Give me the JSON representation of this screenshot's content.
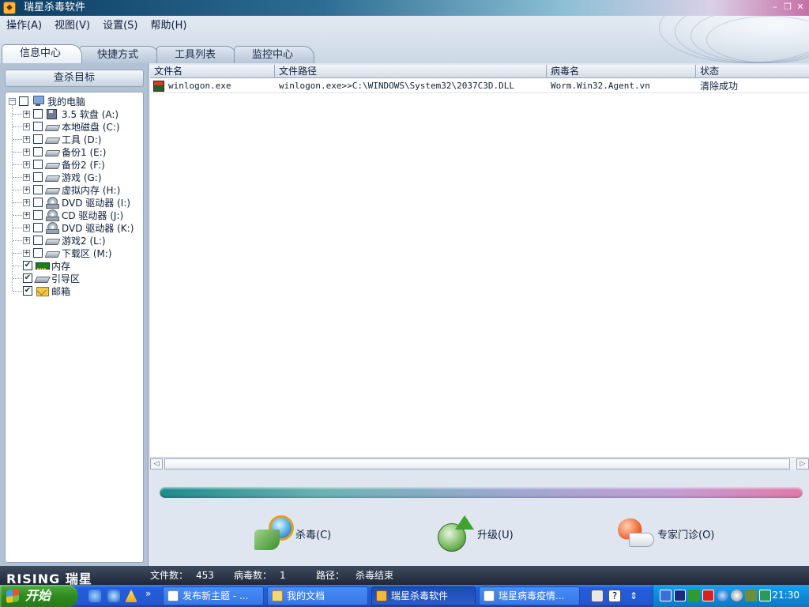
{
  "window": {
    "title": "瑞星杀毒软件",
    "icon": "rising-lion-icon",
    "controls": [
      "minimize-icon",
      "restore-icon",
      "close-icon"
    ]
  },
  "menu": [
    {
      "label": "操作(A)"
    },
    {
      "label": "视图(V)"
    },
    {
      "label": "设置(S)"
    },
    {
      "label": "帮助(H)"
    }
  ],
  "tabs": [
    {
      "label": "信息中心",
      "active": true
    },
    {
      "label": "快捷方式",
      "active": false
    },
    {
      "label": "工具列表",
      "active": false
    },
    {
      "label": "监控中心",
      "active": false
    }
  ],
  "left_panel": {
    "header": "查杀目标",
    "tree": {
      "root": {
        "label": "我的电脑",
        "icon": "computer-icon",
        "checked": false
      },
      "drives": [
        {
          "label": "3.5 软盘 (A:)",
          "icon": "floppy-icon",
          "checked": false
        },
        {
          "label": "本地磁盘 (C:)",
          "icon": "hard-disk-icon",
          "checked": false
        },
        {
          "label": "工具 (D:)",
          "icon": "hard-disk-icon",
          "checked": false
        },
        {
          "label": "备份1 (E:)",
          "icon": "hard-disk-icon",
          "checked": false
        },
        {
          "label": "备份2 (F:)",
          "icon": "hard-disk-icon",
          "checked": false
        },
        {
          "label": "游戏 (G:)",
          "icon": "hard-disk-icon",
          "checked": false
        },
        {
          "label": "虚拟内存 (H:)",
          "icon": "hard-disk-icon",
          "checked": false
        },
        {
          "label": "DVD 驱动器 (I:)",
          "icon": "dvd-drive-icon",
          "checked": false
        },
        {
          "label": "CD 驱动器 (J:)",
          "icon": "cd-drive-icon",
          "checked": false
        },
        {
          "label": "DVD 驱动器 (K:)",
          "icon": "dvd-drive-icon",
          "checked": false
        },
        {
          "label": "游戏2 (L:)",
          "icon": "hard-disk-icon",
          "checked": false
        },
        {
          "label": "下载区 (M:)",
          "icon": "hard-disk-icon",
          "checked": false
        }
      ],
      "others": [
        {
          "label": "内存",
          "icon": "memory-icon",
          "checked": true
        },
        {
          "label": "引导区",
          "icon": "boot-sector-icon",
          "checked": true
        },
        {
          "label": "邮箱",
          "icon": "mailbox-icon",
          "checked": true
        }
      ]
    }
  },
  "results_table": {
    "columns": [
      "文件名",
      "文件路径",
      "病毒名",
      "状态"
    ],
    "rows": [
      {
        "icon": "virus-file-icon",
        "filename": "winlogon.exe",
        "path": "winlogon.exe>>C:\\WINDOWS\\System32\\2037C3D.DLL",
        "virus": "Worm.Win32.Agent.vn",
        "status": "清除成功"
      }
    ]
  },
  "progress": {
    "value": 1.0
  },
  "actions": [
    {
      "label": "杀毒(C)",
      "icon": "scan-magnifier-icon"
    },
    {
      "label": "升级(U)",
      "icon": "upgrade-globe-icon"
    },
    {
      "label": "专家门诊(O)",
      "icon": "expert-clinic-icon"
    }
  ],
  "statusbar": {
    "logo": "RISING 瑞星",
    "files_label": "文件数：",
    "files_value": "453",
    "virus_label": "病毒数：",
    "virus_value": "1",
    "path_label": "路径：",
    "path_value": "杀毒结束"
  },
  "taskbar": {
    "start_label": "开始",
    "quick_launch": [
      "ie-icon",
      "ie-icon",
      "warning-icon"
    ],
    "more": "»",
    "tasks": [
      {
        "label": "发布新主题 - ...",
        "icon": "document-icon",
        "active": false
      },
      {
        "label": "我的文档",
        "icon": "folder-icon",
        "active": false
      },
      {
        "label": "瑞星杀毒软件",
        "icon": "rising-lion-icon",
        "active": true
      },
      {
        "label": "瑞星病毒疫情...",
        "icon": "document-icon",
        "active": false
      }
    ],
    "tray_icons": [
      "keyboard-icon",
      "help-icon",
      "arrow-icon",
      "network-icon",
      "media-icon",
      "tree-icon",
      "flash-icon",
      "ie-icon",
      "disc-icon",
      "tool-icon",
      "shield-icon"
    ],
    "clock": "21:30"
  },
  "colors": {
    "accent": "#1e8a8a",
    "panel": "#b2c1d4",
    "taskbar": "#245edb"
  }
}
